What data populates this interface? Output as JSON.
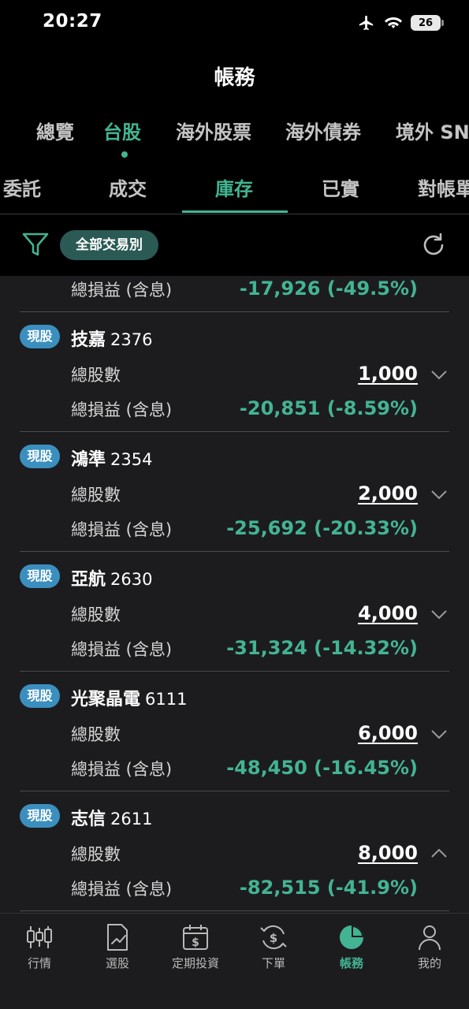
{
  "status_bar": {
    "time": "20:27",
    "battery": "26"
  },
  "page_title": "帳務",
  "top_tabs": [
    {
      "label": "總覽",
      "active": false
    },
    {
      "label": "台股",
      "active": true
    },
    {
      "label": "海外股票",
      "active": false
    },
    {
      "label": "海外債券",
      "active": false
    },
    {
      "label": "境外 SN",
      "active": false
    }
  ],
  "sub_tabs": [
    {
      "label": "委託",
      "active": false
    },
    {
      "label": "成交",
      "active": false
    },
    {
      "label": "庫存",
      "active": true
    },
    {
      "label": "已實",
      "active": false
    },
    {
      "label": "對帳單",
      "active": false
    }
  ],
  "filter": {
    "chip_label": "全部交易別"
  },
  "labels": {
    "total_shares": "總股數",
    "total_pl": "總損益 (含息)"
  },
  "partial_row": {
    "pl": "-17,926 (-49.5%)"
  },
  "holdings": [
    {
      "type": "現股",
      "name": "技嘉",
      "code": "2376",
      "shares": "1,000",
      "pl": "-20,851 (-8.59%)",
      "expanded": false
    },
    {
      "type": "現股",
      "name": "鴻準",
      "code": "2354",
      "shares": "2,000",
      "pl": "-25,692 (-20.33%)",
      "expanded": false
    },
    {
      "type": "現股",
      "name": "亞航",
      "code": "2630",
      "shares": "4,000",
      "pl": "-31,324 (-14.32%)",
      "expanded": false
    },
    {
      "type": "現股",
      "name": "光聚晶電",
      "code": "6111",
      "shares": "6,000",
      "pl": "-48,450 (-16.45%)",
      "expanded": false
    },
    {
      "type": "現股",
      "name": "志信",
      "code": "2611",
      "shares": "8,000",
      "pl": "-82,515 (-41.9%)",
      "expanded": true
    }
  ],
  "bottom_nav": [
    {
      "label": "行情",
      "icon": "candlestick-icon",
      "active": false
    },
    {
      "label": "選股",
      "icon": "chart-doc-icon",
      "active": false
    },
    {
      "label": "定期投資",
      "icon": "calendar-dollar-icon",
      "active": false
    },
    {
      "label": "下單",
      "icon": "dollar-cycle-icon",
      "active": false
    },
    {
      "label": "帳務",
      "icon": "pie-chart-icon",
      "active": true
    },
    {
      "label": "我的",
      "icon": "person-icon",
      "active": false
    }
  ],
  "colors": {
    "accent": "#43b493",
    "badge": "#3b8fbf",
    "chip": "#2b5a55",
    "background": "#1c1c1e"
  }
}
